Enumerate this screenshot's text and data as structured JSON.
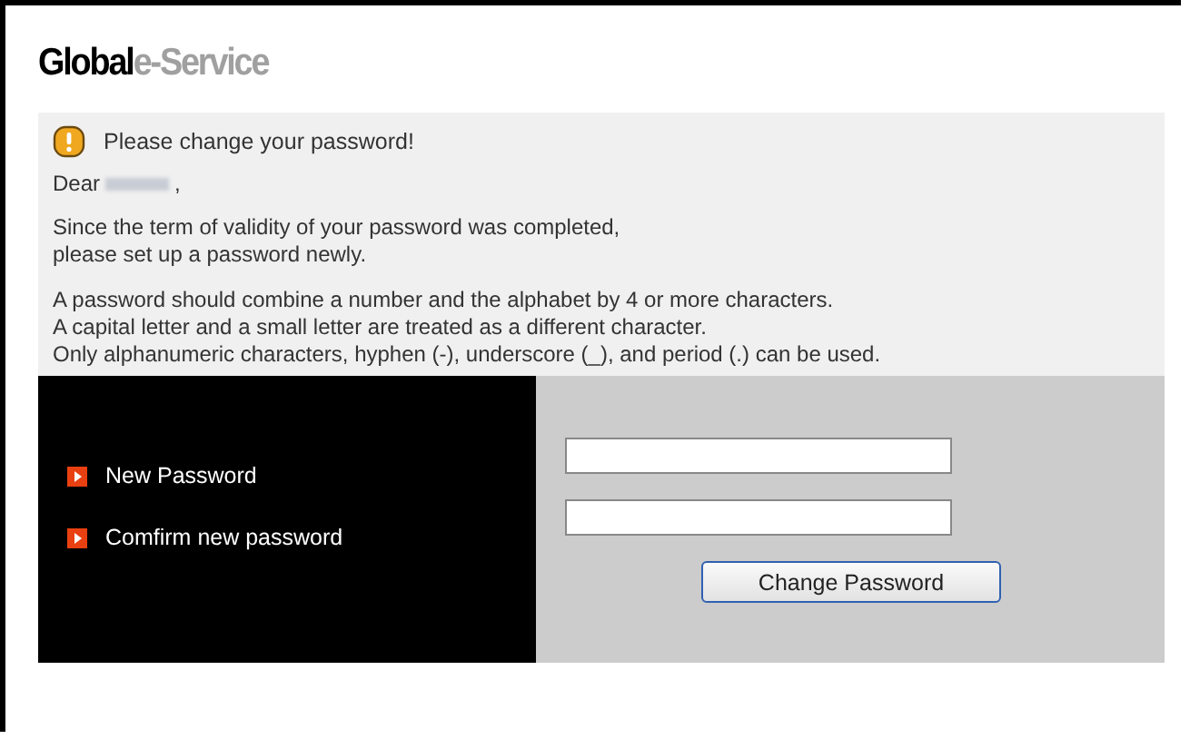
{
  "logo": {
    "primary": "Global",
    "secondary": "e-Service"
  },
  "notice": {
    "message": "Please change your password!",
    "greeting_start": "Dear",
    "greeting_end": ",",
    "paragraphs": [
      [
        "Since the term of validity of your password was completed,",
        "please set up a password newly."
      ],
      [
        "A password should combine a number and the alphabet by 4 or more characters.",
        "A capital letter and a small letter are treated as a different character.",
        "Only alphanumeric characters, hyphen (-), underscore (_), and period (.) can be used."
      ]
    ]
  },
  "form": {
    "fields": [
      {
        "label": "New Password"
      },
      {
        "label": "Comfirm new password"
      }
    ],
    "submit": "Change Password"
  }
}
